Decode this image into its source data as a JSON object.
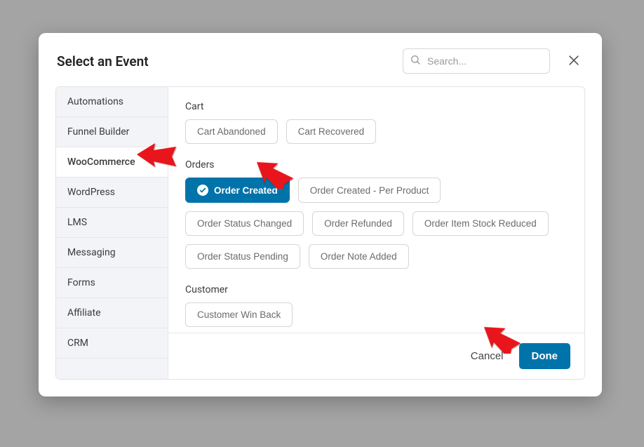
{
  "header": {
    "title": "Select an Event",
    "search_placeholder": "Search..."
  },
  "sidebar": {
    "items": [
      {
        "id": "automations",
        "label": "Automations",
        "active": false
      },
      {
        "id": "funnel-builder",
        "label": "Funnel Builder",
        "active": false
      },
      {
        "id": "woocommerce",
        "label": "WooCommerce",
        "active": true
      },
      {
        "id": "wordpress",
        "label": "WordPress",
        "active": false
      },
      {
        "id": "lms",
        "label": "LMS",
        "active": false
      },
      {
        "id": "messaging",
        "label": "Messaging",
        "active": false
      },
      {
        "id": "forms",
        "label": "Forms",
        "active": false
      },
      {
        "id": "affiliate",
        "label": "Affiliate",
        "active": false
      },
      {
        "id": "crm",
        "label": "CRM",
        "active": false
      }
    ]
  },
  "content": {
    "sections": [
      {
        "id": "cart",
        "title": "Cart",
        "events": [
          {
            "id": "cart-abandoned",
            "label": "Cart Abandoned",
            "selected": false
          },
          {
            "id": "cart-recovered",
            "label": "Cart Recovered",
            "selected": false
          }
        ]
      },
      {
        "id": "orders",
        "title": "Orders",
        "events": [
          {
            "id": "order-created",
            "label": "Order Created",
            "selected": true
          },
          {
            "id": "order-created-per-product",
            "label": "Order Created - Per Product",
            "selected": false
          },
          {
            "id": "order-status-changed",
            "label": "Order Status Changed",
            "selected": false
          },
          {
            "id": "order-refunded",
            "label": "Order Refunded",
            "selected": false
          },
          {
            "id": "order-item-stock-reduced",
            "label": "Order Item Stock Reduced",
            "selected": false
          },
          {
            "id": "order-status-pending",
            "label": "Order Status Pending",
            "selected": false
          },
          {
            "id": "order-note-added",
            "label": "Order Note Added",
            "selected": false
          }
        ]
      },
      {
        "id": "customer",
        "title": "Customer",
        "events": [
          {
            "id": "customer-win-back",
            "label": "Customer Win Back",
            "selected": false
          }
        ]
      }
    ]
  },
  "footer": {
    "cancel_label": "Cancel",
    "done_label": "Done"
  },
  "colors": {
    "accent": "#0073aa",
    "arrow": "#e8171f"
  }
}
